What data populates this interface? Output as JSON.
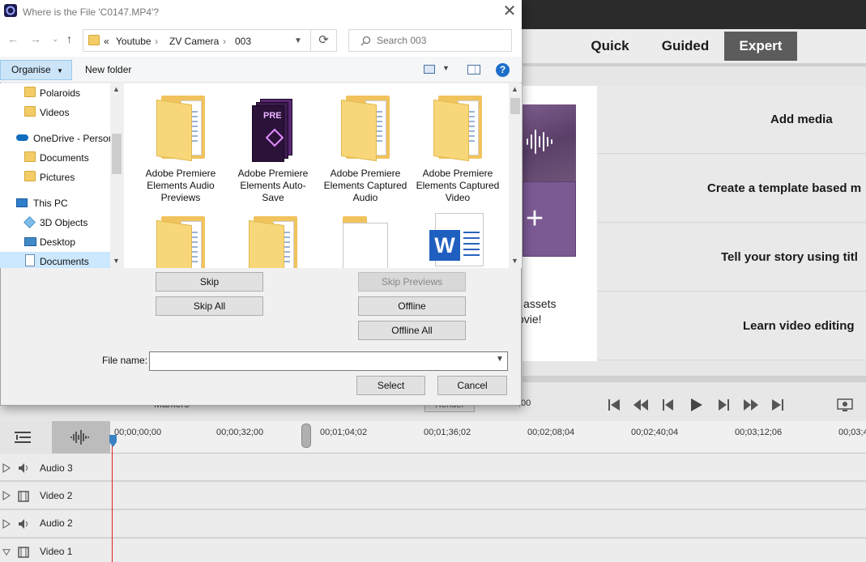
{
  "app": {
    "modes": [
      "Quick",
      "Guided",
      "Expert"
    ],
    "active_mode": "Expert",
    "welcome_text": "nage assets\nur movie!",
    "menu": [
      "Add media",
      "Create a template based m",
      "Tell your story using titl",
      "Learn video editing"
    ],
    "transport": {
      "markers_label": "Markers",
      "render_label": "Render",
      "timecode": ";00"
    },
    "ruler_ticks": [
      "00;00;00;00",
      "00;00;32;00",
      "00;01;04;02",
      "00;01;36;02",
      "00;02;08;04",
      "00;02;40;04",
      "00;03;12;06",
      "00;03;4"
    ],
    "tracks": [
      "Audio 3",
      "Video 2",
      "Audio 2",
      "Video 1"
    ]
  },
  "dialog": {
    "title": "Where is the File 'C0147.MP4'?",
    "breadcrumbs": [
      "Youtube",
      "ZV Camera",
      "003"
    ],
    "breadcrumb_prefix": "«",
    "search_placeholder": "Search 003",
    "toolbar": {
      "organise": "Organise",
      "new_folder": "New folder",
      "help": "?"
    },
    "nav_items": [
      "Polaroids",
      "Videos",
      "OneDrive - Person",
      "Documents",
      "Pictures",
      "This PC",
      "3D Objects",
      "Desktop",
      "Documents"
    ],
    "files": [
      "Adobe Premiere Elements Audio Previews",
      "Adobe Premiere Elements Auto-Save",
      "Adobe Premiere Elements Captured Audio",
      "Adobe Premiere Elements Captured Video"
    ],
    "pr_icon_text": "PRE",
    "word_icon_text": "W",
    "buttons": {
      "skip": "Skip",
      "skip_all": "Skip All",
      "skip_previews": "Skip Previews",
      "offline": "Offline",
      "offline_all": "Offline All",
      "select": "Select",
      "cancel": "Cancel"
    },
    "file_name_label": "File name:",
    "file_name_value": ""
  },
  "colors": {
    "accent_selected": "#cce8ff",
    "organise_bg": "#cce4f7",
    "mode_active": "#5c5c5c",
    "playhead": "#e02020"
  }
}
